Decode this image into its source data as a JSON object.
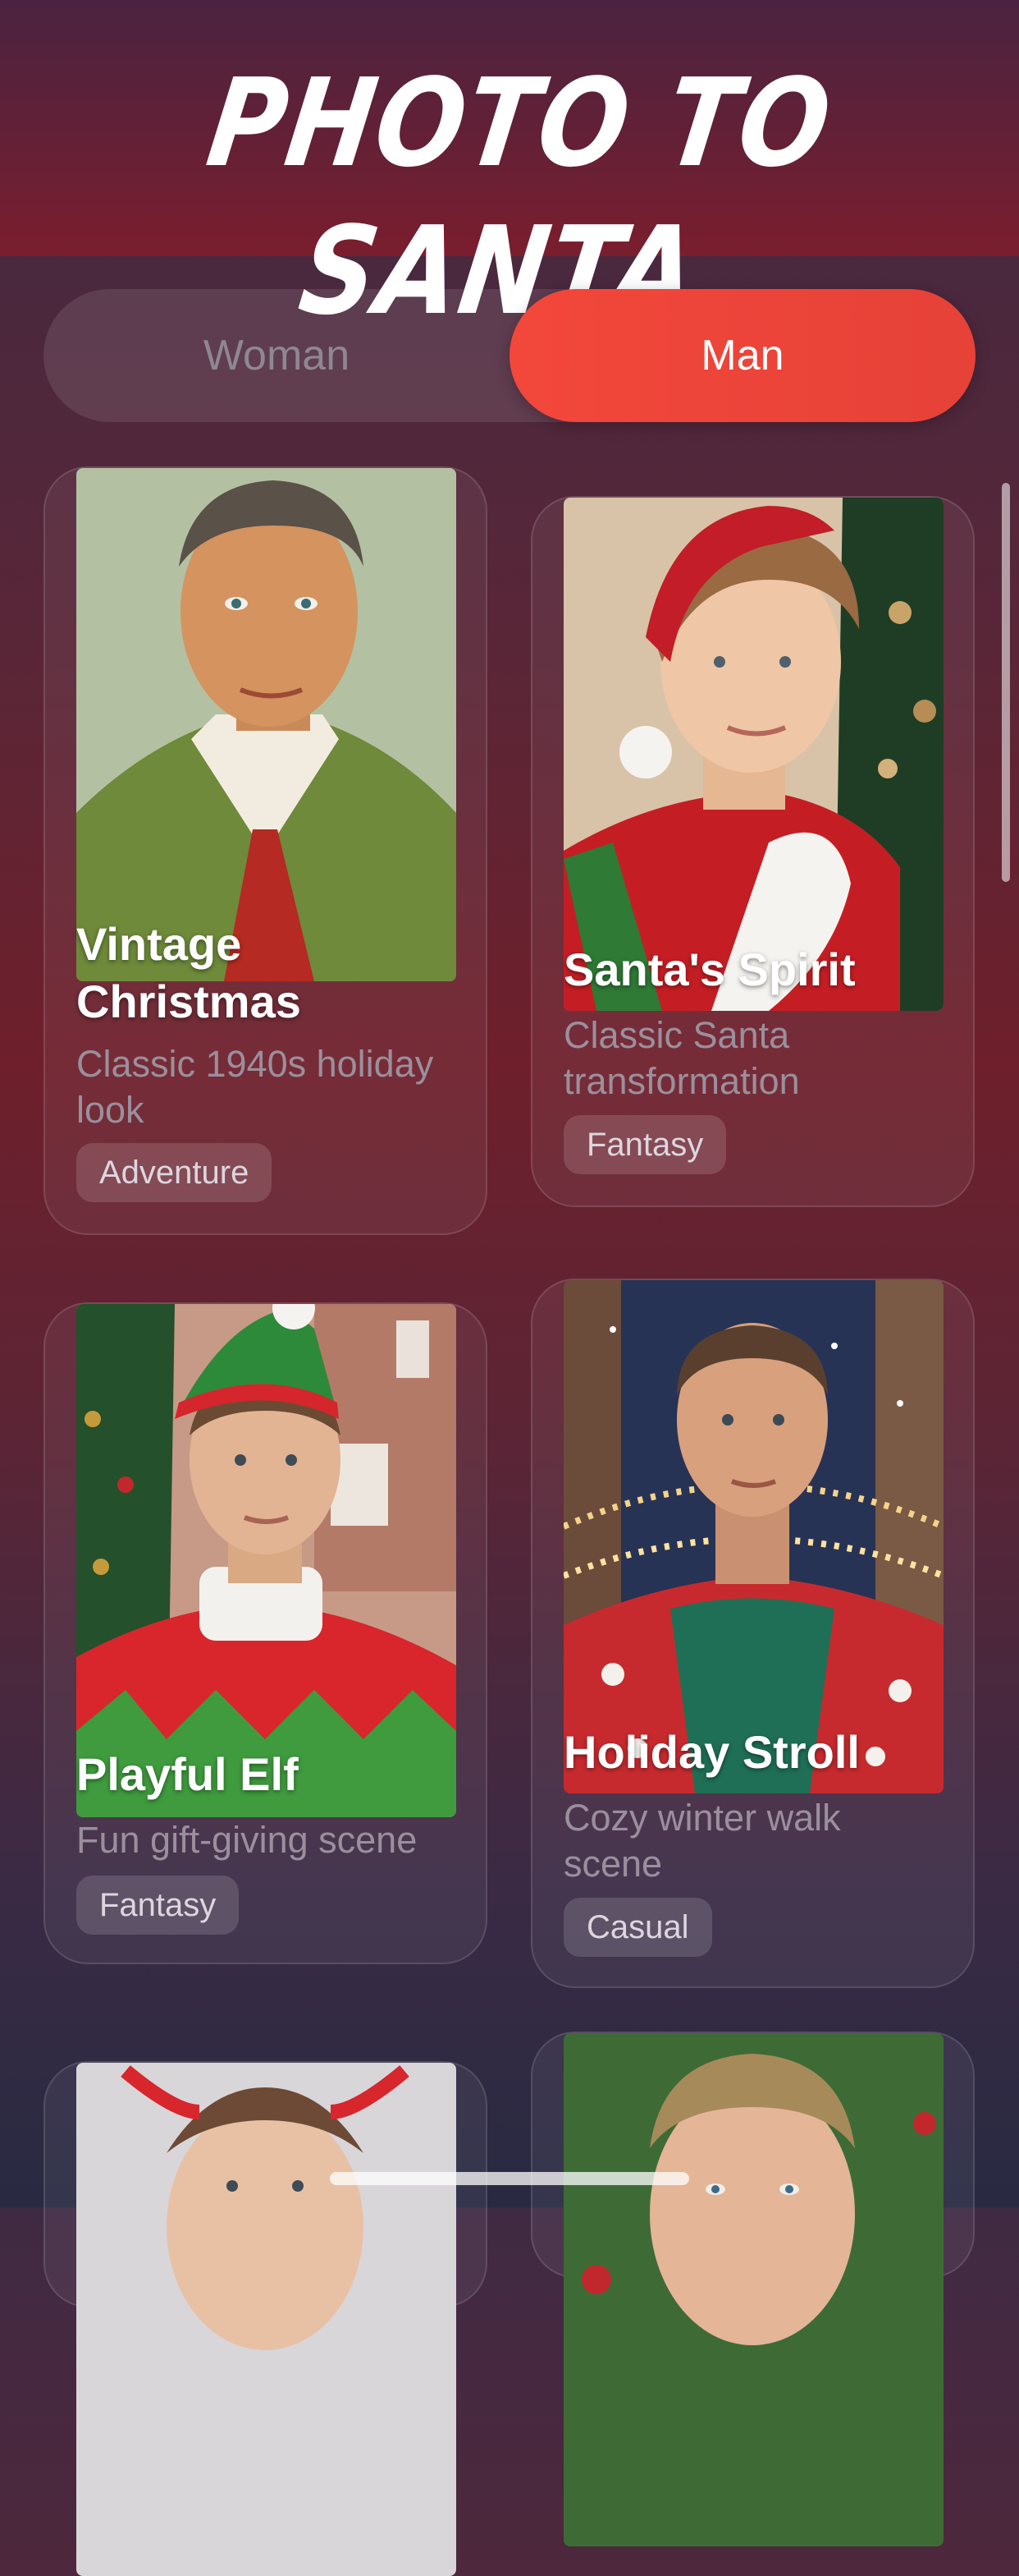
{
  "header": {
    "title": "PHOTO TO SANTA"
  },
  "gender_toggle": {
    "options": [
      "Woman",
      "Man"
    ],
    "selected": "Man"
  },
  "styles": [
    {
      "title": "Vintage Christmas",
      "description": "Classic 1940s holiday look",
      "tag": "Adventure"
    },
    {
      "title": "Santa's Spirit",
      "description": "Classic Santa transformation",
      "tag": "Fantasy"
    },
    {
      "title": "Playful Elf",
      "description": "Fun gift-giving scene",
      "tag": "Fantasy"
    },
    {
      "title": "Holiday Stroll",
      "description": "Cozy winter walk scene",
      "tag": "Casual"
    }
  ],
  "colors": {
    "accent": "#f3473b",
    "background": "#5a2637"
  }
}
